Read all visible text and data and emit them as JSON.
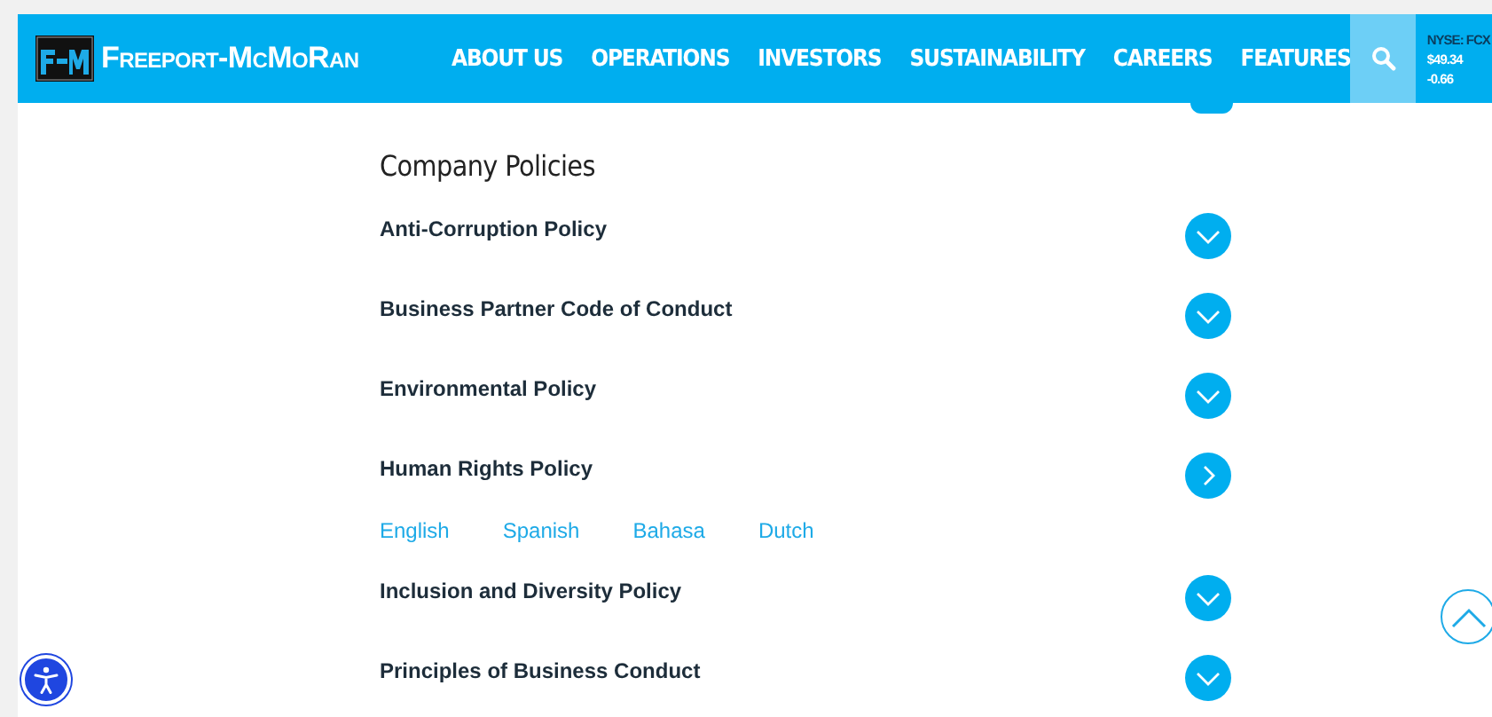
{
  "header": {
    "logo_text": "Freeport-McMoRan",
    "nav": [
      "ABOUT US",
      "OPERATIONS",
      "INVESTORS",
      "SUSTAINABILITY",
      "CAREERS",
      "FEATURES"
    ],
    "stock": {
      "ticker": "NYSE: FCX",
      "price": "$49.34",
      "change": "-0.66"
    }
  },
  "section": {
    "title": "Company Policies",
    "policies": [
      {
        "name": "Anti-Corruption Policy",
        "expanded": false
      },
      {
        "name": "Business Partner Code of Conduct",
        "expanded": false
      },
      {
        "name": "Environmental Policy",
        "expanded": false
      },
      {
        "name": "Human Rights Policy",
        "expanded": true,
        "links": [
          "English",
          "Spanish",
          "Bahasa",
          "Dutch"
        ]
      },
      {
        "name": "Inclusion and Diversity Policy",
        "expanded": false
      },
      {
        "name": "Principles of Business Conduct",
        "expanded": false
      }
    ]
  }
}
